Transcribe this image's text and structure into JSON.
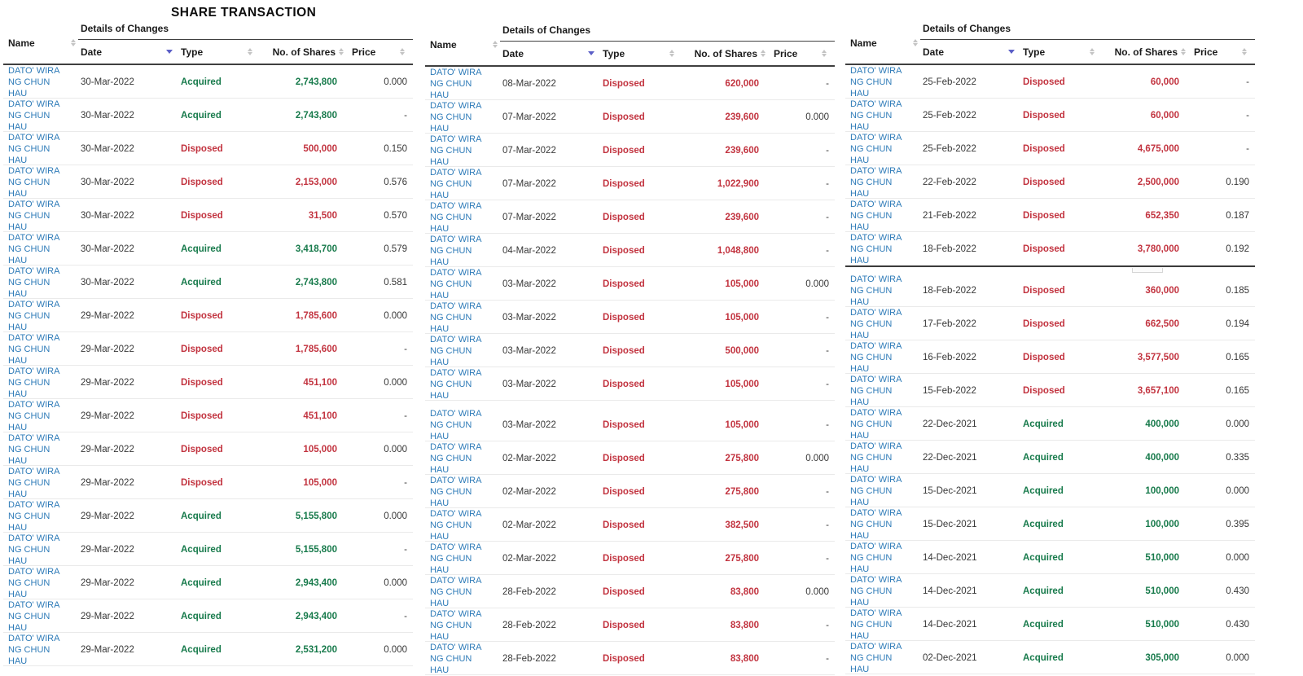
{
  "title": "SHARE TRANSACTION",
  "shareholder": "DATO' WIRA NG CHUN HAU",
  "colors": {
    "link_blue": "#2e7bb8",
    "acquired_green": "#177a4b",
    "disposed_red": "#c2333f",
    "sort_active_triangle": "#5b5fc7",
    "sort_inactive_gray": "#c4c4c4"
  },
  "icons": {
    "name_sort": "sort-arrows-icon",
    "date_sort": "sort-desc-icon",
    "type_sort": "sort-arrows-icon",
    "shares_sort": "sort-arrows-icon",
    "price_sort": "sort-arrows-icon"
  },
  "table_labels": {
    "name": "Name",
    "group": "Details of Changes",
    "date": "Date",
    "type": "Type",
    "shares": "No. of Shares",
    "price": "Price"
  },
  "row_format": [
    "name",
    "date",
    "type",
    "shares",
    "price"
  ],
  "tables": [
    {
      "id": "share-table-1",
      "divider": null,
      "sections": [
        [
          [
            "DATO' WIRA NG CHUN HAU",
            "30-Mar-2022",
            "Acquired",
            "2,743,800",
            "0.000"
          ],
          [
            "DATO' WIRA NG CHUN HAU",
            "30-Mar-2022",
            "Acquired",
            "2,743,800",
            "-"
          ],
          [
            "DATO' WIRA NG CHUN HAU",
            "30-Mar-2022",
            "Disposed",
            "500,000",
            "0.150"
          ],
          [
            "DATO' WIRA NG CHUN HAU",
            "30-Mar-2022",
            "Disposed",
            "2,153,000",
            "0.576"
          ],
          [
            "DATO' WIRA NG CHUN HAU",
            "30-Mar-2022",
            "Disposed",
            "31,500",
            "0.570"
          ],
          [
            "DATO' WIRA NG CHUN HAU",
            "30-Mar-2022",
            "Acquired",
            "3,418,700",
            "0.579"
          ],
          [
            "DATO' WIRA NG CHUN HAU",
            "30-Mar-2022",
            "Acquired",
            "2,743,800",
            "0.581"
          ],
          [
            "DATO' WIRA NG CHUN HAU",
            "29-Mar-2022",
            "Disposed",
            "1,785,600",
            "0.000"
          ],
          [
            "DATO' WIRA NG CHUN HAU",
            "29-Mar-2022",
            "Disposed",
            "1,785,600",
            "-"
          ],
          [
            "DATO' WIRA NG CHUN HAU",
            "29-Mar-2022",
            "Disposed",
            "451,100",
            "0.000"
          ],
          [
            "DATO' WIRA NG CHUN HAU",
            "29-Mar-2022",
            "Disposed",
            "451,100",
            "-"
          ],
          [
            "DATO' WIRA NG CHUN HAU",
            "29-Mar-2022",
            "Disposed",
            "105,000",
            "0.000"
          ],
          [
            "DATO' WIRA NG CHUN HAU",
            "29-Mar-2022",
            "Disposed",
            "105,000",
            "-"
          ],
          [
            "DATO' WIRA NG CHUN HAU",
            "29-Mar-2022",
            "Acquired",
            "5,155,800",
            "0.000"
          ],
          [
            "DATO' WIRA NG CHUN HAU",
            "29-Mar-2022",
            "Acquired",
            "5,155,800",
            "-"
          ],
          [
            "DATO' WIRA NG CHUN HAU",
            "29-Mar-2022",
            "Acquired",
            "2,943,400",
            "0.000"
          ],
          [
            "DATO' WIRA NG CHUN HAU",
            "29-Mar-2022",
            "Acquired",
            "2,943,400",
            "-"
          ],
          [
            "DATO' WIRA NG CHUN HAU",
            "29-Mar-2022",
            "Acquired",
            "2,531,200",
            "0.000"
          ]
        ]
      ]
    },
    {
      "id": "share-table-2",
      "divider": "gap",
      "sections": [
        [
          [
            "DATO' WIRA NG CHUN HAU",
            "08-Mar-2022",
            "Disposed",
            "620,000",
            "-"
          ],
          [
            "DATO' WIRA NG CHUN HAU",
            "07-Mar-2022",
            "Disposed",
            "239,600",
            "0.000"
          ],
          [
            "DATO' WIRA NG CHUN HAU",
            "07-Mar-2022",
            "Disposed",
            "239,600",
            "-"
          ],
          [
            "DATO' WIRA NG CHUN HAU",
            "07-Mar-2022",
            "Disposed",
            "1,022,900",
            "-"
          ],
          [
            "DATO' WIRA NG CHUN HAU",
            "07-Mar-2022",
            "Disposed",
            "239,600",
            "-"
          ],
          [
            "DATO' WIRA NG CHUN HAU",
            "04-Mar-2022",
            "Disposed",
            "1,048,800",
            "-"
          ],
          [
            "DATO' WIRA NG CHUN HAU",
            "03-Mar-2022",
            "Disposed",
            "105,000",
            "0.000"
          ],
          [
            "DATO' WIRA NG CHUN HAU",
            "03-Mar-2022",
            "Disposed",
            "105,000",
            "-"
          ],
          [
            "DATO' WIRA NG CHUN HAU",
            "03-Mar-2022",
            "Disposed",
            "500,000",
            "-"
          ],
          [
            "DATO' WIRA NG CHUN HAU",
            "03-Mar-2022",
            "Disposed",
            "105,000",
            "-"
          ]
        ],
        [
          [
            "DATO' WIRA NG CHUN HAU",
            "03-Mar-2022",
            "Disposed",
            "105,000",
            "-"
          ],
          [
            "DATO' WIRA NG CHUN HAU",
            "02-Mar-2022",
            "Disposed",
            "275,800",
            "0.000"
          ],
          [
            "DATO' WIRA NG CHUN HAU",
            "02-Mar-2022",
            "Disposed",
            "275,800",
            "-"
          ],
          [
            "DATO' WIRA NG CHUN HAU",
            "02-Mar-2022",
            "Disposed",
            "382,500",
            "-"
          ],
          [
            "DATO' WIRA NG CHUN HAU",
            "02-Mar-2022",
            "Disposed",
            "275,800",
            "-"
          ],
          [
            "DATO' WIRA NG CHUN HAU",
            "28-Feb-2022",
            "Disposed",
            "83,800",
            "0.000"
          ],
          [
            "DATO' WIRA NG CHUN HAU",
            "28-Feb-2022",
            "Disposed",
            "83,800",
            "-"
          ],
          [
            "DATO' WIRA NG CHUN HAU",
            "28-Feb-2022",
            "Disposed",
            "83,800",
            "-"
          ]
        ]
      ]
    },
    {
      "id": "share-table-3",
      "divider": "line",
      "sections": [
        [
          [
            "DATO' WIRA NG CHUN HAU",
            "25-Feb-2022",
            "Disposed",
            "60,000",
            "-"
          ],
          [
            "DATO' WIRA NG CHUN HAU",
            "25-Feb-2022",
            "Disposed",
            "60,000",
            "-"
          ],
          [
            "DATO' WIRA NG CHUN HAU",
            "25-Feb-2022",
            "Disposed",
            "4,675,000",
            "-"
          ],
          [
            "DATO' WIRA NG CHUN HAU",
            "22-Feb-2022",
            "Disposed",
            "2,500,000",
            "0.190"
          ],
          [
            "DATO' WIRA NG CHUN HAU",
            "21-Feb-2022",
            "Disposed",
            "652,350",
            "0.187"
          ],
          [
            "DATO' WIRA NG CHUN HAU",
            "18-Feb-2022",
            "Disposed",
            "3,780,000",
            "0.192"
          ]
        ],
        [
          [
            "DATO' WIRA NG CHUN HAU",
            "18-Feb-2022",
            "Disposed",
            "360,000",
            "0.185"
          ],
          [
            "DATO' WIRA NG CHUN HAU",
            "17-Feb-2022",
            "Disposed",
            "662,500",
            "0.194"
          ],
          [
            "DATO' WIRA NG CHUN HAU",
            "16-Feb-2022",
            "Disposed",
            "3,577,500",
            "0.165"
          ],
          [
            "DATO' WIRA NG CHUN HAU",
            "15-Feb-2022",
            "Disposed",
            "3,657,100",
            "0.165"
          ],
          [
            "DATO' WIRA NG CHUN HAU",
            "22-Dec-2021",
            "Acquired",
            "400,000",
            "0.000"
          ],
          [
            "DATO' WIRA NG CHUN HAU",
            "22-Dec-2021",
            "Acquired",
            "400,000",
            "0.335"
          ],
          [
            "DATO' WIRA NG CHUN HAU",
            "15-Dec-2021",
            "Acquired",
            "100,000",
            "0.000"
          ],
          [
            "DATO' WIRA NG CHUN HAU",
            "15-Dec-2021",
            "Acquired",
            "100,000",
            "0.395"
          ],
          [
            "DATO' WIRA NG CHUN HAU",
            "14-Dec-2021",
            "Acquired",
            "510,000",
            "0.000"
          ],
          [
            "DATO' WIRA NG CHUN HAU",
            "14-Dec-2021",
            "Acquired",
            "510,000",
            "0.430"
          ],
          [
            "DATO' WIRA NG CHUN HAU",
            "14-Dec-2021",
            "Acquired",
            "510,000",
            "0.430"
          ],
          [
            "DATO' WIRA NG CHUN HAU",
            "02-Dec-2021",
            "Acquired",
            "305,000",
            "0.000"
          ]
        ]
      ]
    }
  ]
}
